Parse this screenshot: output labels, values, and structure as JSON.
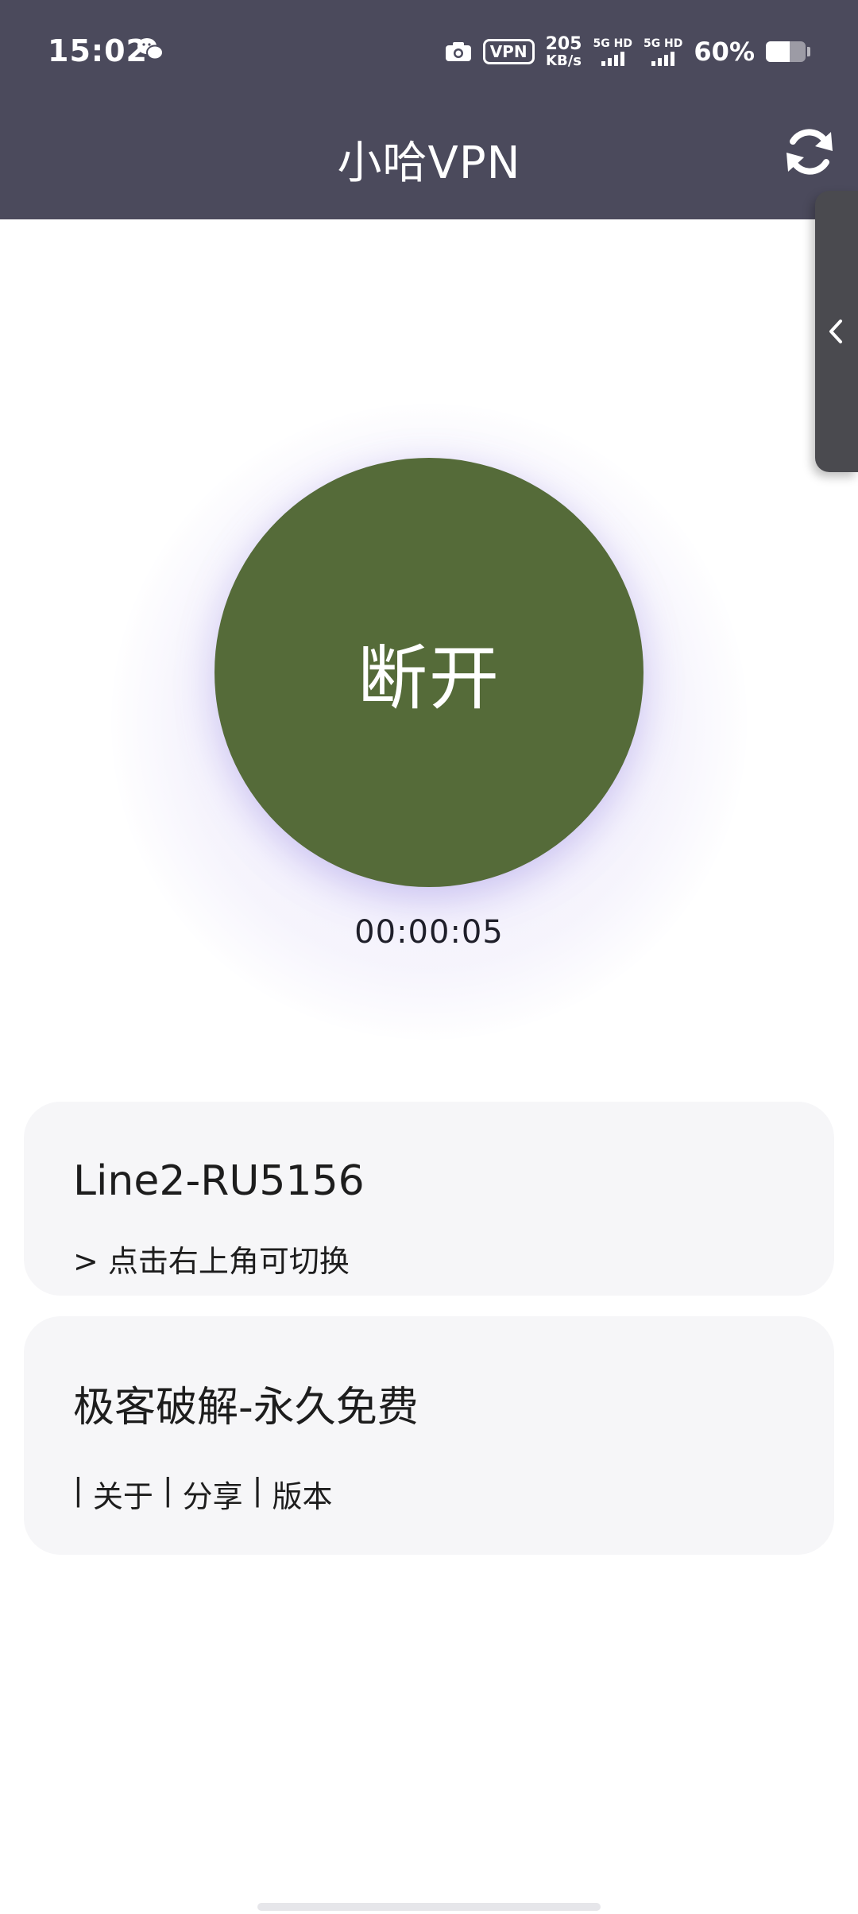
{
  "status_bar": {
    "time": "15:02",
    "vpn_badge": "VPN",
    "net_speed_value": "205",
    "net_speed_unit": "KB/s",
    "sim1_label": "5G HD",
    "sim2_label": "5G HD",
    "battery_percent": "60%"
  },
  "header": {
    "title": "小哈VPN"
  },
  "connect": {
    "button_label": "断开",
    "timer": "00:00:05",
    "button_color": "#556b39"
  },
  "line_card": {
    "title": "Line2-RU5156",
    "hint": "> 点击右上角可切换"
  },
  "info_card": {
    "title": "极客破解-永久免费",
    "links": [
      {
        "label": "关于"
      },
      {
        "label": "分享"
      },
      {
        "label": "版本"
      }
    ],
    "separator": "|"
  },
  "colors": {
    "header_bg": "#4b4a5c",
    "card_bg": "#f6f6f8"
  }
}
